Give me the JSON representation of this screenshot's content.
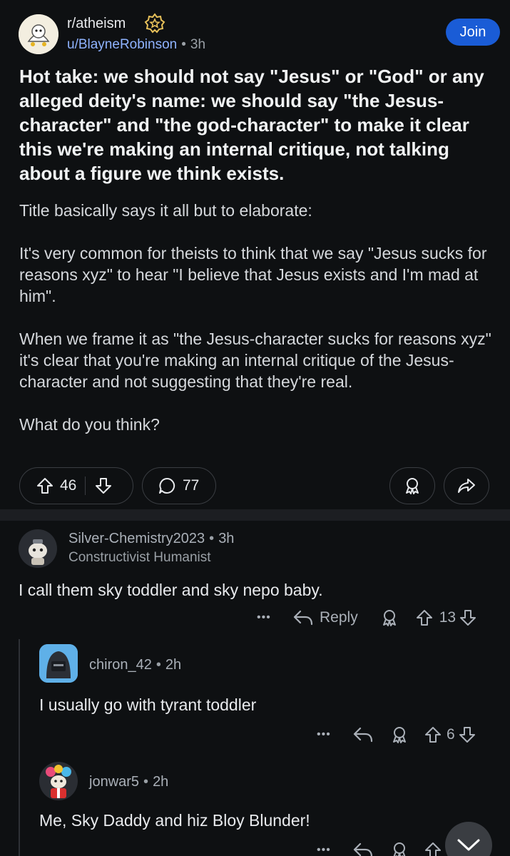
{
  "post": {
    "subreddit": "r/atheism",
    "author": "u/BlayneRobinson",
    "time": "3h",
    "join_label": "Join",
    "title": "Hot take: we should not say \"Jesus\" or \"God\" or any alleged deity's name: we should say \"the Jesus-character\" and \"the god-character\" to make it clear this we're making an internal critique, not talking about a figure we think exists.",
    "body": [
      "Title basically says it all but to elaborate:",
      "It's very common for theists to think that we say \"Jesus sucks for reasons xyz\" to hear \"I believe that Jesus exists and I'm mad at him\".",
      "When we frame it as \"the Jesus-character sucks for reasons xyz\" it's clear that you're making an internal critique of the Jesus-character and not suggesting that they're real.",
      "What do you think?"
    ],
    "upvotes": "46",
    "comments": "77"
  },
  "comments": [
    {
      "user": "Silver-Chemistry2023",
      "time": "3h",
      "flair": "Constructivist Humanist",
      "text": "I call them sky toddler and sky nepo baby.",
      "reply_label": "Reply",
      "votes": "13",
      "more": "•••"
    },
    {
      "user": "chiron_42",
      "time": "2h",
      "text": "I usually go with tyrant toddler",
      "votes": "6",
      "more": "•••"
    },
    {
      "user": "jonwar5",
      "time": "2h",
      "text": "Me, Sky Daddy and hiz Bloy Blunder!",
      "more": "•••"
    }
  ],
  "colors": {
    "background": "#0e1012",
    "accent": "#1a5cd6",
    "link": "#8fb3ff"
  }
}
